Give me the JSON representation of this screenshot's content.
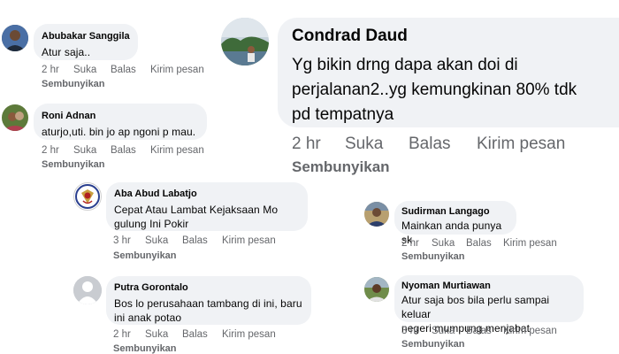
{
  "comments": [
    {
      "name": "Abubakar Sanggila",
      "text": "Atur saja..",
      "time": "2 hr",
      "like": "Suka",
      "reply": "Balas",
      "message": "Kirim pesan",
      "hide": "Sembunyikan"
    },
    {
      "name": "Roni Adnan",
      "text": "aturjo,uti. bin jo ap ngoni p mau.",
      "time": "2 hr",
      "like": "Suka",
      "reply": "Balas",
      "message": "Kirim pesan",
      "hide": "Sembunyikan"
    },
    {
      "name": "Aba Abud Labatjo",
      "text_lines": [
        "Cepat Atau Lambat Kejaksaan Mo",
        "gulung Ini Pokir"
      ],
      "time": "3 hr",
      "like": "Suka",
      "reply": "Balas",
      "message": "Kirim pesan",
      "hide": "Sembunyikan"
    },
    {
      "name": "Putra Gorontalo",
      "text_lines": [
        "Bos lo perusahaan tambang di ini, baru",
        "ini anak potao"
      ],
      "time": "2 hr",
      "like": "Suka",
      "reply": "Balas",
      "message": "Kirim pesan",
      "hide": "Sembunyikan"
    },
    {
      "name": "Condrad Daud",
      "text_lines": [
        "Yg bikin drng dapa akan doi di",
        "perjalanan2..yg kemungkinan 80% tdk",
        "pd tempatnya"
      ],
      "time": "2 hr",
      "like": "Suka",
      "reply": "Balas",
      "message": "Kirim pesan",
      "hide": "Sembunyikan"
    },
    {
      "name": "Sudirman Langago",
      "text": "Mainkan anda punya sk",
      "time": "2 hr",
      "like": "Suka",
      "reply": "Balas",
      "message": "Kirim pesan",
      "hide": "Sembunyikan"
    },
    {
      "name": "Nyoman Murtiawan",
      "text_lines": [
        "Atur saja bos bila perlu sampai keluar",
        "negeri mumpung menjabat"
      ],
      "time": "3 hr",
      "like": "Suka",
      "reply": "Balas",
      "message": "Kirim pesan",
      "hide": "Sembunyikan"
    }
  ],
  "colors": {
    "bubble": "#f0f2f5",
    "meta": "#65676b",
    "text": "#050505"
  },
  "icons": [
    "avatar-photo",
    "avatar-photo",
    "emblem-icon",
    "default-avatar-icon",
    "avatar-photo",
    "avatar-photo",
    "avatar-photo"
  ]
}
